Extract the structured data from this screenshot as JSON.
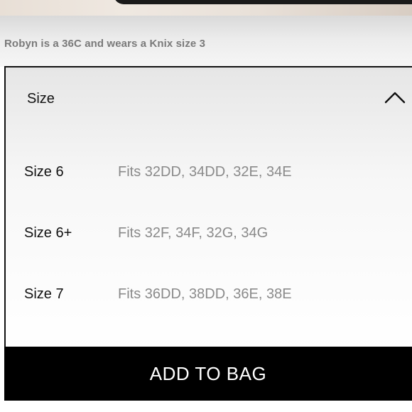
{
  "caption": "Robyn is a 36C and wears a Knix size 3",
  "size_selector": {
    "title": "Size",
    "expanded_icon": "chevron-up-icon",
    "options": [
      {
        "size": "Size 6",
        "fits": "Fits 32DD, 34DD, 32E, 34E"
      },
      {
        "size": "Size 6+",
        "fits": "Fits 32F, 34F, 32G, 34G"
      },
      {
        "size": "Size 7",
        "fits": "Fits 36DD, 38DD, 36E, 38E"
      }
    ]
  },
  "add_to_bag": {
    "label": "ADD TO BAG",
    "background": "#000000",
    "text_color": "#ffffff"
  }
}
